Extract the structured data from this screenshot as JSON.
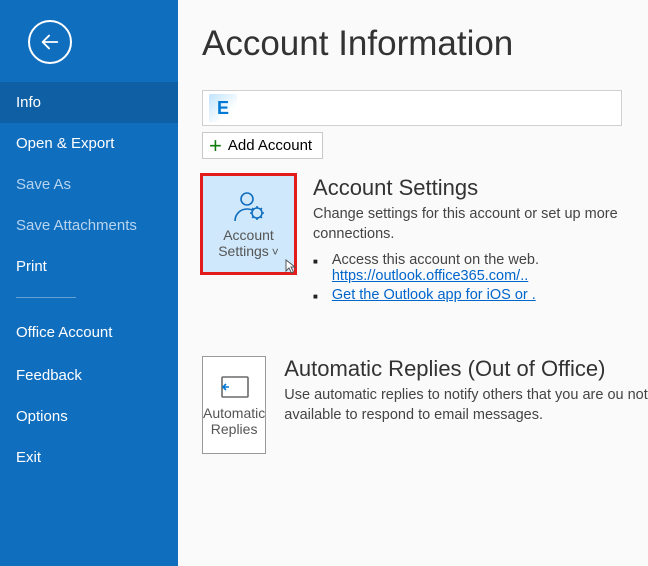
{
  "sidebar": {
    "items": [
      {
        "label": "Info"
      },
      {
        "label": "Open & Export"
      },
      {
        "label": "Save As"
      },
      {
        "label": "Save Attachments"
      },
      {
        "label": "Print"
      },
      {
        "label": "Office Account"
      },
      {
        "label": "Feedback"
      },
      {
        "label": "Options"
      },
      {
        "label": "Exit"
      }
    ]
  },
  "main": {
    "title": "Account Information",
    "add_account_label": "Add Account",
    "account_settings": {
      "tile_label": "Account Settings",
      "heading": "Account Settings",
      "description": "Change settings for this account or set up more connections.",
      "bullet1_text": "Access this account on the web.",
      "bullet1_link": "https://outlook.office365.com/..",
      "bullet2_link": "Get the Outlook app for iOS or ."
    },
    "auto_replies": {
      "tile_label": "Automatic Replies",
      "heading": "Automatic Replies (Out of Office)",
      "description": "Use automatic replies to notify others that you are ou not available to respond to email messages."
    }
  }
}
